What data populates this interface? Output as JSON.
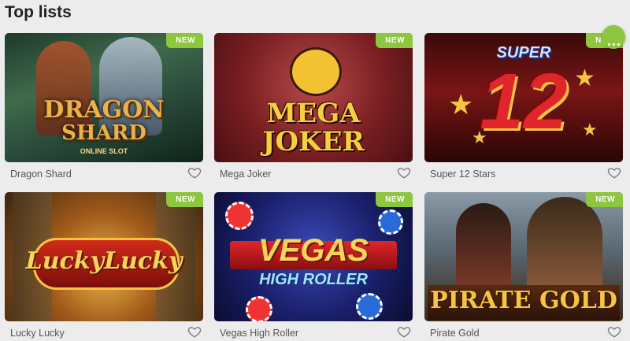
{
  "section": {
    "title": "Top lists"
  },
  "badge_color": "#8dc63f",
  "games": [
    {
      "name": "Dragon Shard",
      "badge": "NEW",
      "logo_line1": "DRAGON",
      "logo_line2": "SHARD",
      "logo_line3": "ONLINE SLOT"
    },
    {
      "name": "Mega Joker",
      "badge": "NEW",
      "logo_line1": "MEGA",
      "logo_line2": "JOKER"
    },
    {
      "name": "Super 12 Stars",
      "badge": "NEW",
      "logo_line1": "SUPER",
      "logo_line2": "12"
    },
    {
      "name": "Lucky Lucky",
      "badge": "NEW",
      "logo_line1": "LuckyLucky"
    },
    {
      "name": "Vegas High Roller",
      "badge": "NEW",
      "logo_line1": "VEGAS",
      "logo_line2": "HIGH ROLLER"
    },
    {
      "name": "Pirate Gold",
      "badge": "NEW",
      "logo_line1": "PIRATE GOLD"
    }
  ]
}
